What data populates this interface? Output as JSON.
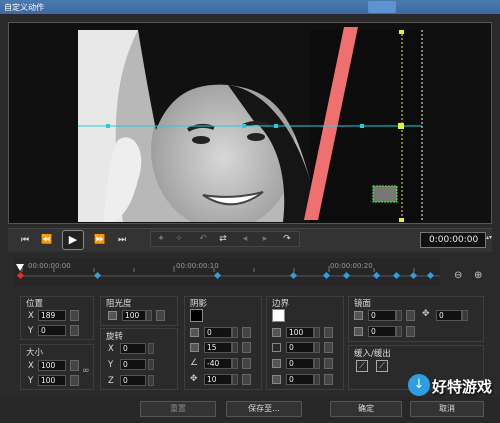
{
  "window": {
    "title": "自定义动作",
    "menu_tab": ""
  },
  "controls": {
    "timecode": "0:00:00:00"
  },
  "timeline": {
    "labels": [
      "00:00:00:00",
      "00:00:00:10",
      "00:00:00:20"
    ]
  },
  "position": {
    "title": "位置",
    "x_label": "X",
    "x": "189",
    "y_label": "Y",
    "y": "0"
  },
  "size": {
    "title": "大小",
    "x_label": "X",
    "x": "100",
    "y_label": "Y",
    "y": "100"
  },
  "opacity": {
    "title": "阻光度",
    "value": "100"
  },
  "rotation": {
    "title": "旋转",
    "x_label": "X",
    "x": "0",
    "y_label": "Y",
    "y": "0",
    "z_label": "Z",
    "z": "0"
  },
  "shadow": {
    "title": "阴影",
    "values": [
      "0",
      "15",
      "-40",
      "10"
    ]
  },
  "border": {
    "title": "边界",
    "values": [
      "100",
      "0",
      "0",
      "0"
    ]
  },
  "mirror": {
    "title": "镜面",
    "values": [
      "0",
      "0",
      "0"
    ]
  },
  "fade": {
    "title": "缓入/缓出"
  },
  "footer": {
    "reset": "重置",
    "save_as": "保存至...",
    "ok": "确定",
    "cancel": "取消"
  },
  "watermark": {
    "text": "好特游戏"
  },
  "colors": {
    "title_bar": "#3d6aa0",
    "accent_line": "#22cfd8",
    "slanted_bar": "#f07070",
    "keyframe": "#2aa0e0"
  }
}
